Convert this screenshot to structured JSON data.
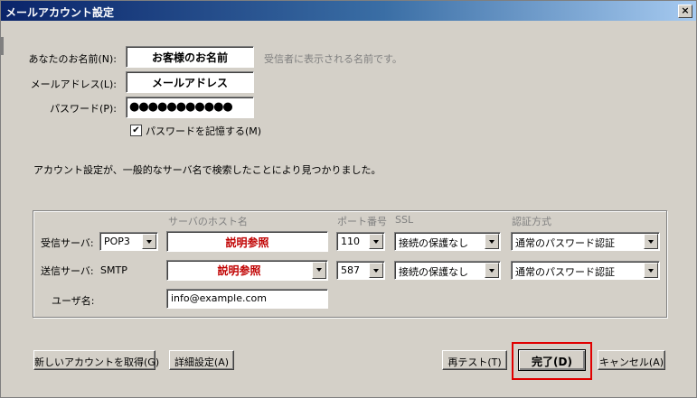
{
  "window": {
    "title": "メールアカウント設定",
    "close": "×"
  },
  "identity": {
    "name_label": "あなたのお名前(N):",
    "name_value": "お客様のお名前",
    "name_hint": "受信者に表示される名前です。",
    "email_label": "メールアドレス(L):",
    "email_value": "メールアドレス",
    "password_label": "パスワード(P):",
    "password_value": "●●●●●●●●●●●",
    "remember_label": "パスワードを記憶する(M)",
    "remember_checked": "✔"
  },
  "status_message": "アカウント設定が、一般的なサーバ名で検索したことにより見つかりました。",
  "servers": {
    "headers": {
      "host": "サーバのホスト名",
      "port": "ポート番号",
      "ssl": "SSL",
      "auth": "認証方式"
    },
    "incoming": {
      "label": "受信サーバ:",
      "protocol": "POP3",
      "host": "説明参照",
      "port": "110",
      "ssl": "接続の保護なし",
      "auth": "通常のパスワード認証"
    },
    "outgoing": {
      "label": "送信サーバ:",
      "protocol": "SMTP",
      "host": "説明参照",
      "port": "587",
      "ssl": "接続の保護なし",
      "auth": "通常のパスワード認証"
    },
    "username_label": "ユーザ名:",
    "username_value": "info@example.com"
  },
  "buttons": {
    "new_account": "新しいアカウントを取得(G)",
    "advanced": "詳細設定(A)",
    "retest": "再テスト(T)",
    "done": "完了(D)",
    "cancel": "キャンセル(A)"
  },
  "colors": {
    "highlight": "#e00000",
    "emphasis_text": "#c00000",
    "dialog_bg": "#d4d0c8"
  }
}
